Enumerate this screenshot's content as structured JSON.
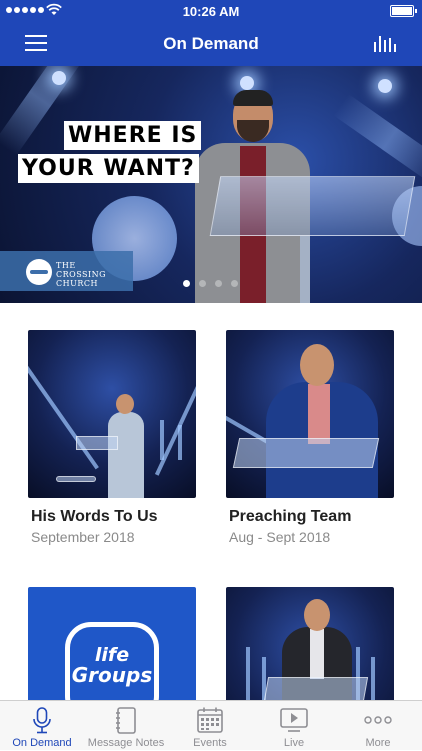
{
  "status_bar": {
    "time": "10:26 AM"
  },
  "nav": {
    "title": "On Demand"
  },
  "hero": {
    "headline_line1": "WHERE IS",
    "headline_line2": "YOUR WANT?",
    "church_name_line1": "THE",
    "church_name_line2": "CROSSING",
    "church_name_line3": "CHURCH",
    "slide_count": 4,
    "active_slide": 1
  },
  "cards": [
    {
      "title": "His Words To Us",
      "subtitle": "September 2018"
    },
    {
      "title": "Preaching Team",
      "subtitle": "Aug - Sept 2018"
    },
    {
      "thumb_text_1": "life",
      "thumb_text_2": "Groups"
    },
    {}
  ],
  "tabs": [
    {
      "label": "On Demand",
      "icon": "microphone-icon",
      "active": true
    },
    {
      "label": "Message Notes",
      "icon": "notebook-icon",
      "active": false
    },
    {
      "label": "Events",
      "icon": "calendar-icon",
      "active": false
    },
    {
      "label": "Live",
      "icon": "play-screen-icon",
      "active": false
    },
    {
      "label": "More",
      "icon": "more-dots-icon",
      "active": false
    }
  ],
  "colors": {
    "brand_blue": "#1f47b8",
    "tab_inactive": "#8e8e93"
  }
}
